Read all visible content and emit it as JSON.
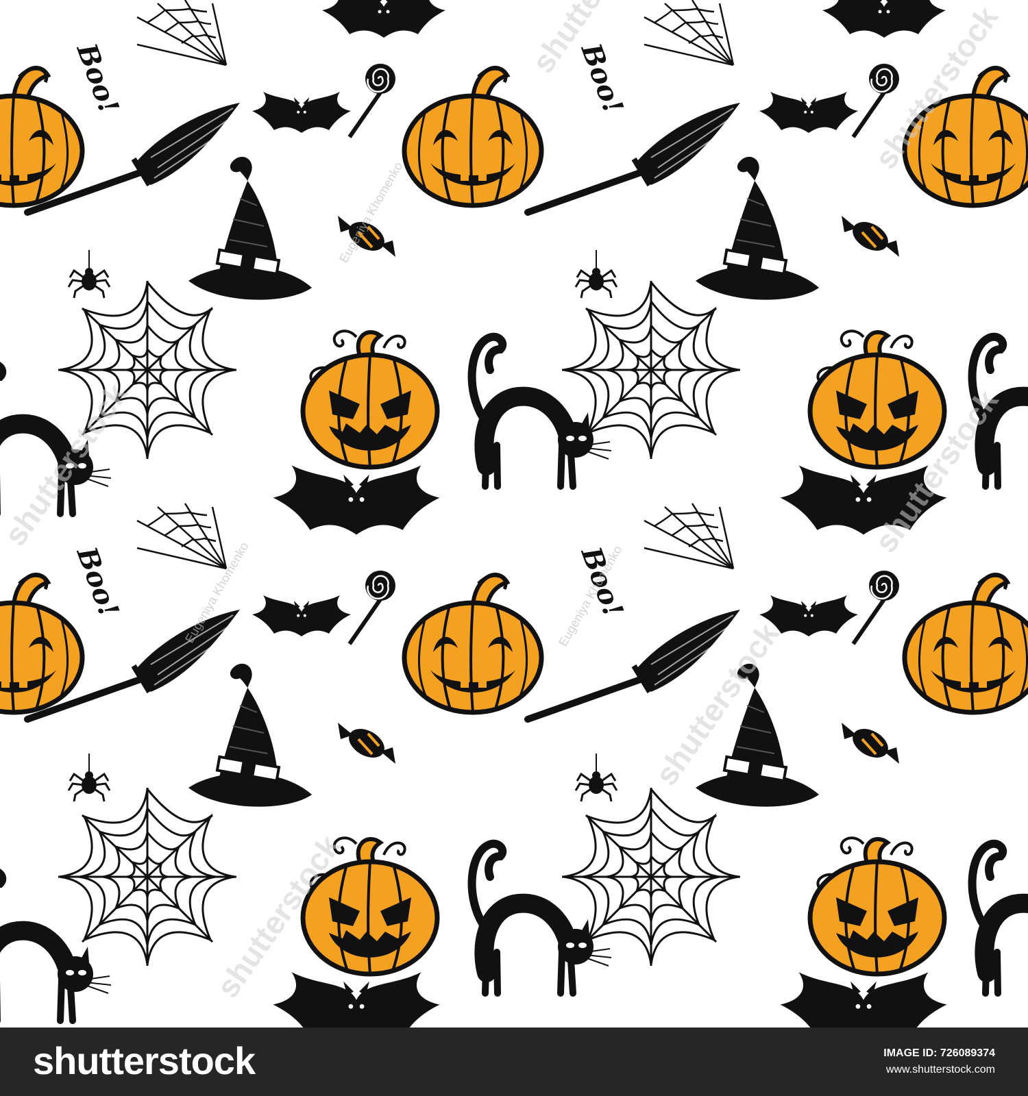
{
  "artwork": {
    "colors": {
      "ink": "#111111",
      "orange": "#f4a020",
      "background": "#ffffff"
    },
    "motifs": [
      "pumpkin",
      "witch-hat",
      "broom",
      "bat",
      "black-cat",
      "spider-web",
      "spider",
      "candy",
      "lollipop",
      "boo-lettering"
    ],
    "boo_text": "Boo!",
    "watermark": {
      "site_text": "shutterstock",
      "author_text": "Eugeniya Khomenko"
    }
  },
  "footer": {
    "brand": "shutterstock",
    "image_id_label": "IMAGE ID: 726089374",
    "site_url": "www.shutterstock.com"
  }
}
